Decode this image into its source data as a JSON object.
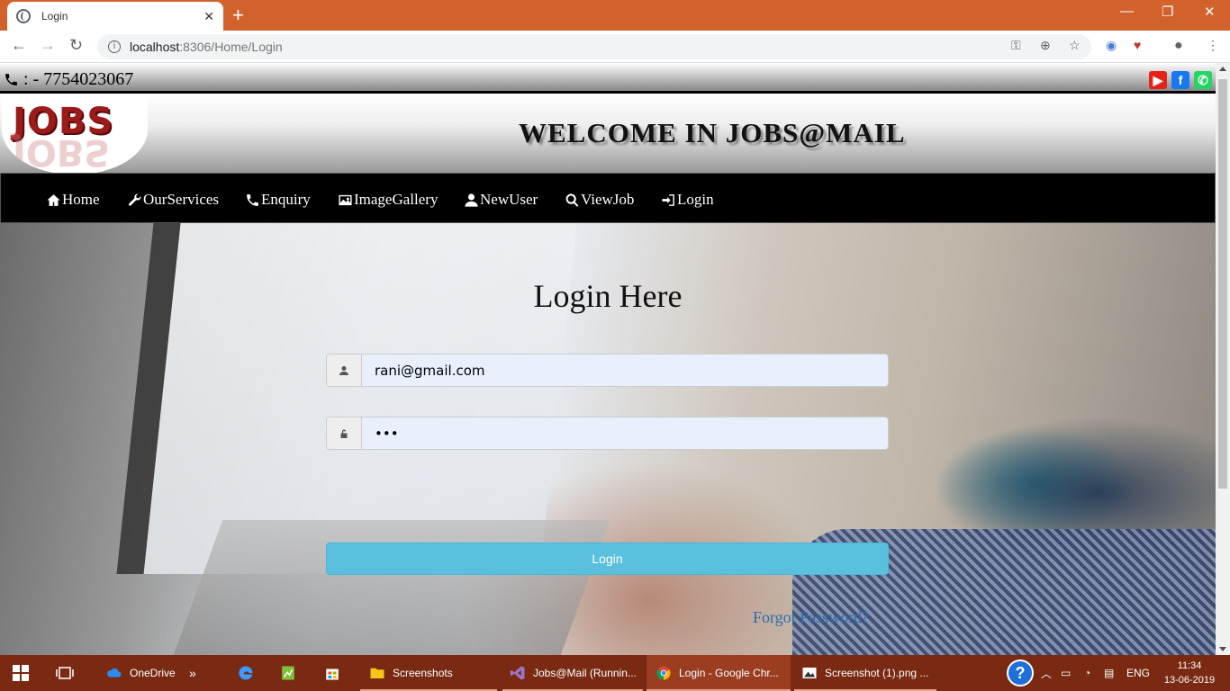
{
  "browser": {
    "tab_title": "Login",
    "tab_close": "✕",
    "new_tab": "+",
    "window_minimize": "—",
    "window_restore": "❐",
    "window_close": "✕",
    "url_host": "localhost",
    "url_rest": ":8306/Home/Login"
  },
  "topstrip": {
    "phone_text": ": - 7754023067",
    "social": [
      {
        "name": "youtube",
        "glyph": "▶",
        "color": "#e62117"
      },
      {
        "name": "facebook",
        "glyph": "f",
        "color": "#1877f2"
      },
      {
        "name": "whatsapp",
        "glyph": "✆",
        "color": "#25d366"
      }
    ]
  },
  "header": {
    "logo_text": "JOBS",
    "welcome": "WELCOME IN JOBS@MAIL"
  },
  "nav": {
    "items": [
      {
        "label": "Home",
        "icon": "home-icon"
      },
      {
        "label": "OurServices",
        "icon": "wrench-icon"
      },
      {
        "label": "Enquiry",
        "icon": "phone-icon"
      },
      {
        "label": "ImageGallery",
        "icon": "picture-icon"
      },
      {
        "label": "NewUser",
        "icon": "user-icon"
      },
      {
        "label": "ViewJob",
        "icon": "search-icon"
      },
      {
        "label": "Login",
        "icon": "login-icon"
      }
    ]
  },
  "login": {
    "title": "Login Here",
    "email_value": "rani@gmail.com",
    "password_value": "•••",
    "button_label": "Login",
    "forgot_label": "Forgot Password?"
  },
  "taskbar": {
    "items": [
      {
        "label": "OneDrive"
      },
      {
        "label": "Screenshots"
      },
      {
        "label": "Jobs@Mail (Runnin..."
      },
      {
        "label": "Login - Google Chr..."
      },
      {
        "label": "Screenshot (1).png ..."
      }
    ],
    "overflow": "»",
    "lang": "ENG",
    "time": "11:34",
    "date": "13-06-2019"
  }
}
